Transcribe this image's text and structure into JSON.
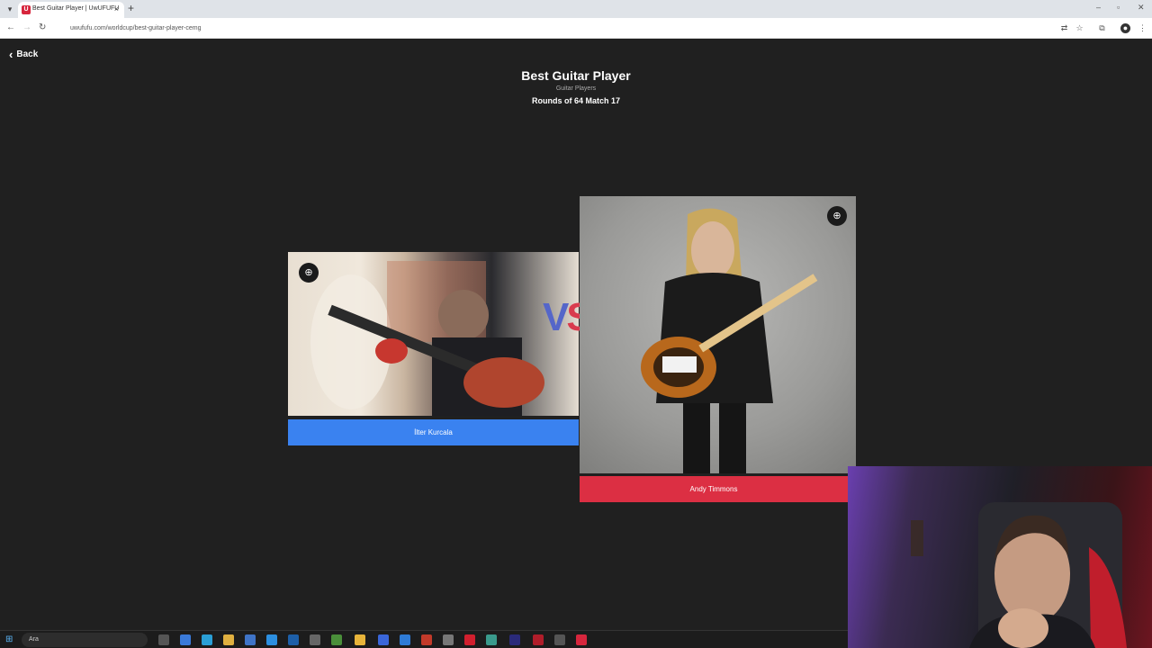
{
  "browser": {
    "tab_title": "Best Guitar Player | UwUFUFU",
    "tab_close": "×",
    "new_tab": "+",
    "url": "uwufufu.com/worldcup/best-guitar-player-cemg"
  },
  "page": {
    "back_label": "Back",
    "title": "Best Guitar Player",
    "subtitle": "Guitar Players",
    "round": "Rounds of 64 Match 17"
  },
  "matchup": {
    "left": {
      "name": "İlter Kurcala"
    },
    "right": {
      "name": "Andy Timmons"
    },
    "vs_v": "V",
    "vs_s": "S"
  },
  "taskbar": {
    "search_placeholder": "Ara"
  },
  "colors": {
    "left_accent": "#3a82f0",
    "right_accent": "#dc2f43",
    "background": "#202020"
  }
}
